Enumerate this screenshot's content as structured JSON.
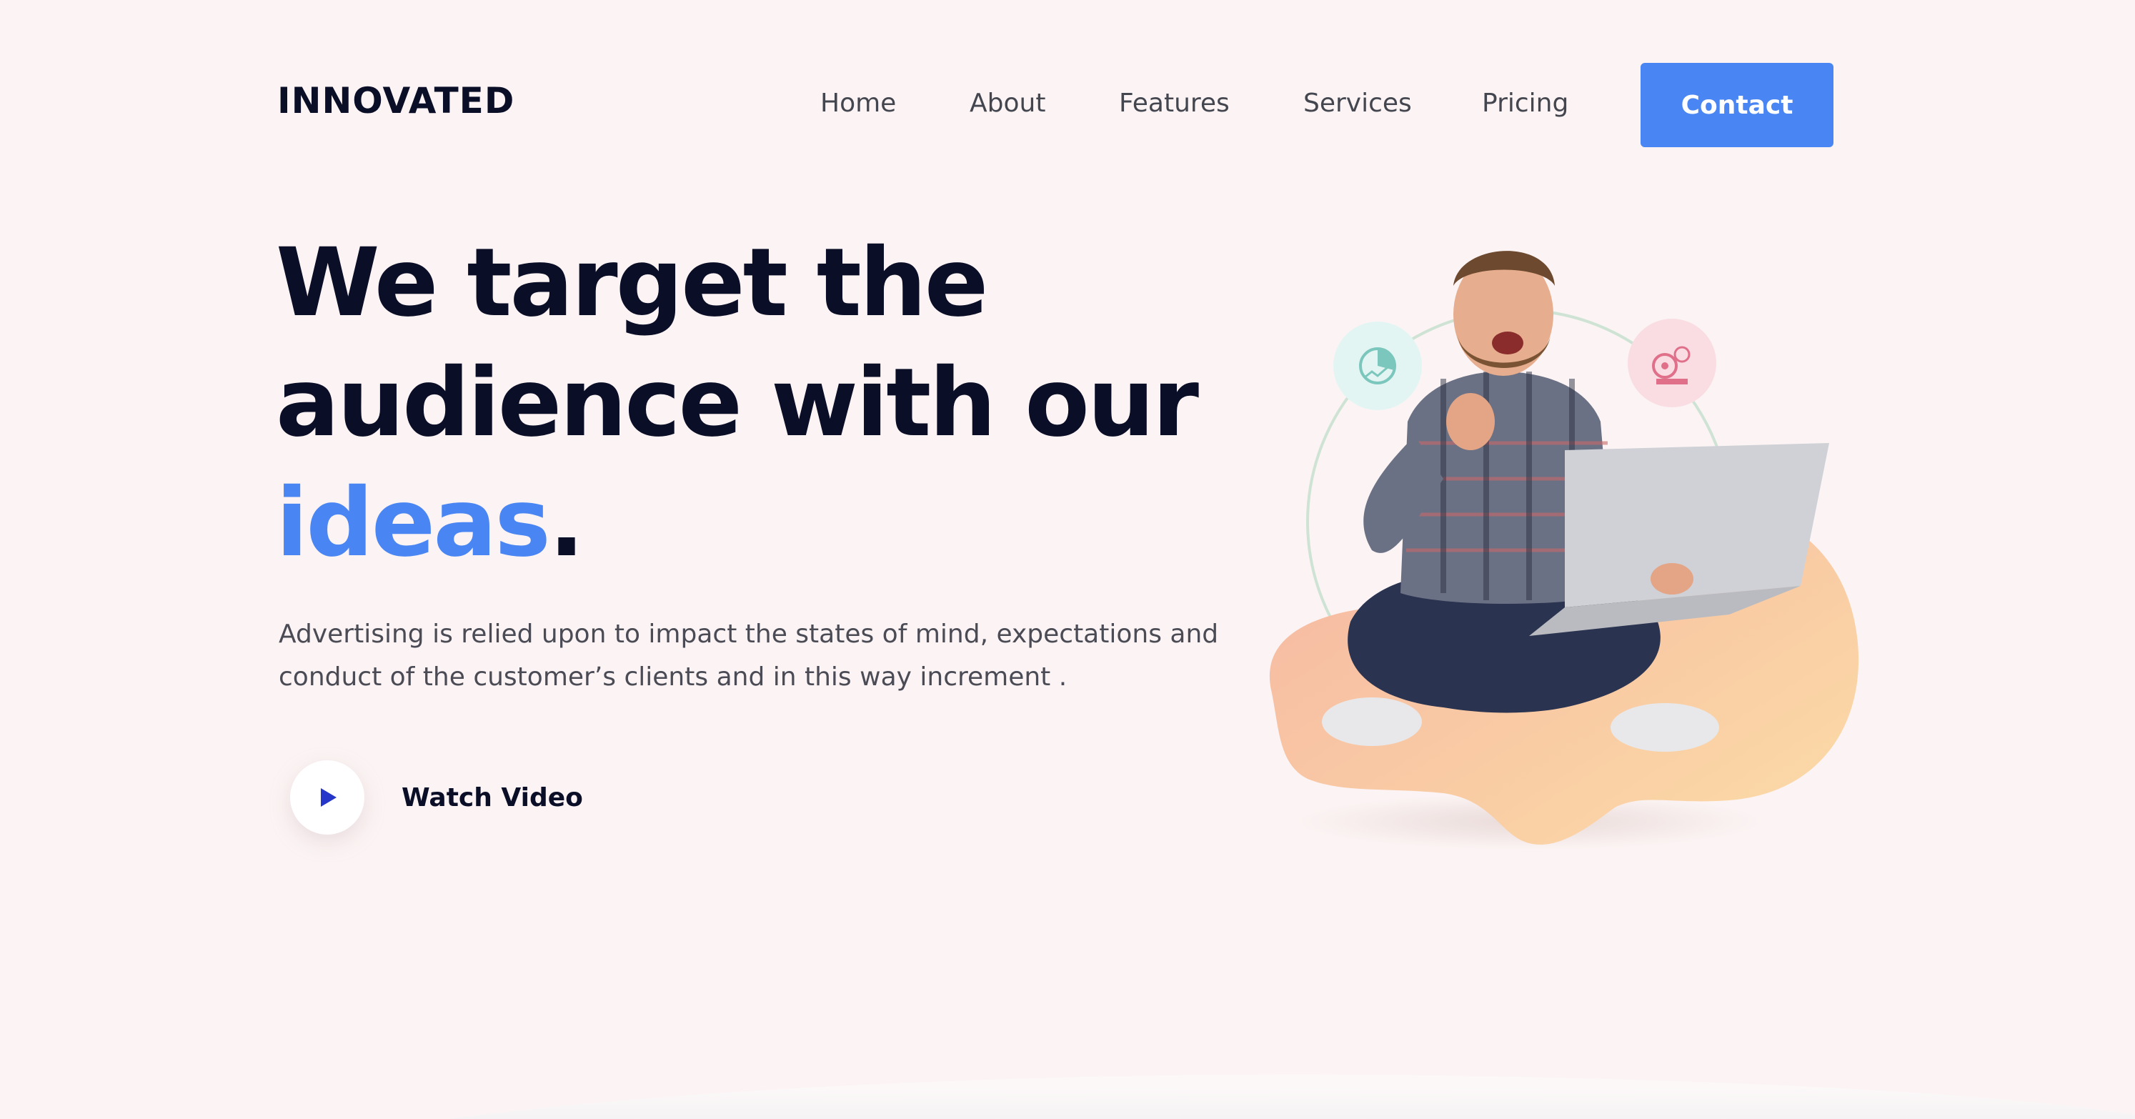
{
  "brand": {
    "logo_text": "INNOVATED"
  },
  "nav": {
    "items": [
      {
        "label": "Home"
      },
      {
        "label": "About"
      },
      {
        "label": "Features"
      },
      {
        "label": "Services"
      },
      {
        "label": "Pricing"
      }
    ],
    "cta_label": "Contact"
  },
  "hero": {
    "headline_line1": "We target the",
    "headline_line2": "audience with our",
    "headline_accent": "ideas",
    "headline_period": ".",
    "description": "Advertising is relied upon to impact the states of mind, expectations and conduct of the customer’s clients and in this way increment .",
    "watch_video_label": "Watch Video",
    "play_icon": "play-icon",
    "illustration_icons": [
      "pie-chart-icon",
      "gears-icon"
    ]
  },
  "colors": {
    "accent": "#4a86f3",
    "heading": "#0b0e27",
    "background": "#fcf4f4",
    "blob_start": "#f6b9a0",
    "blob_end": "#fbd9a6"
  }
}
